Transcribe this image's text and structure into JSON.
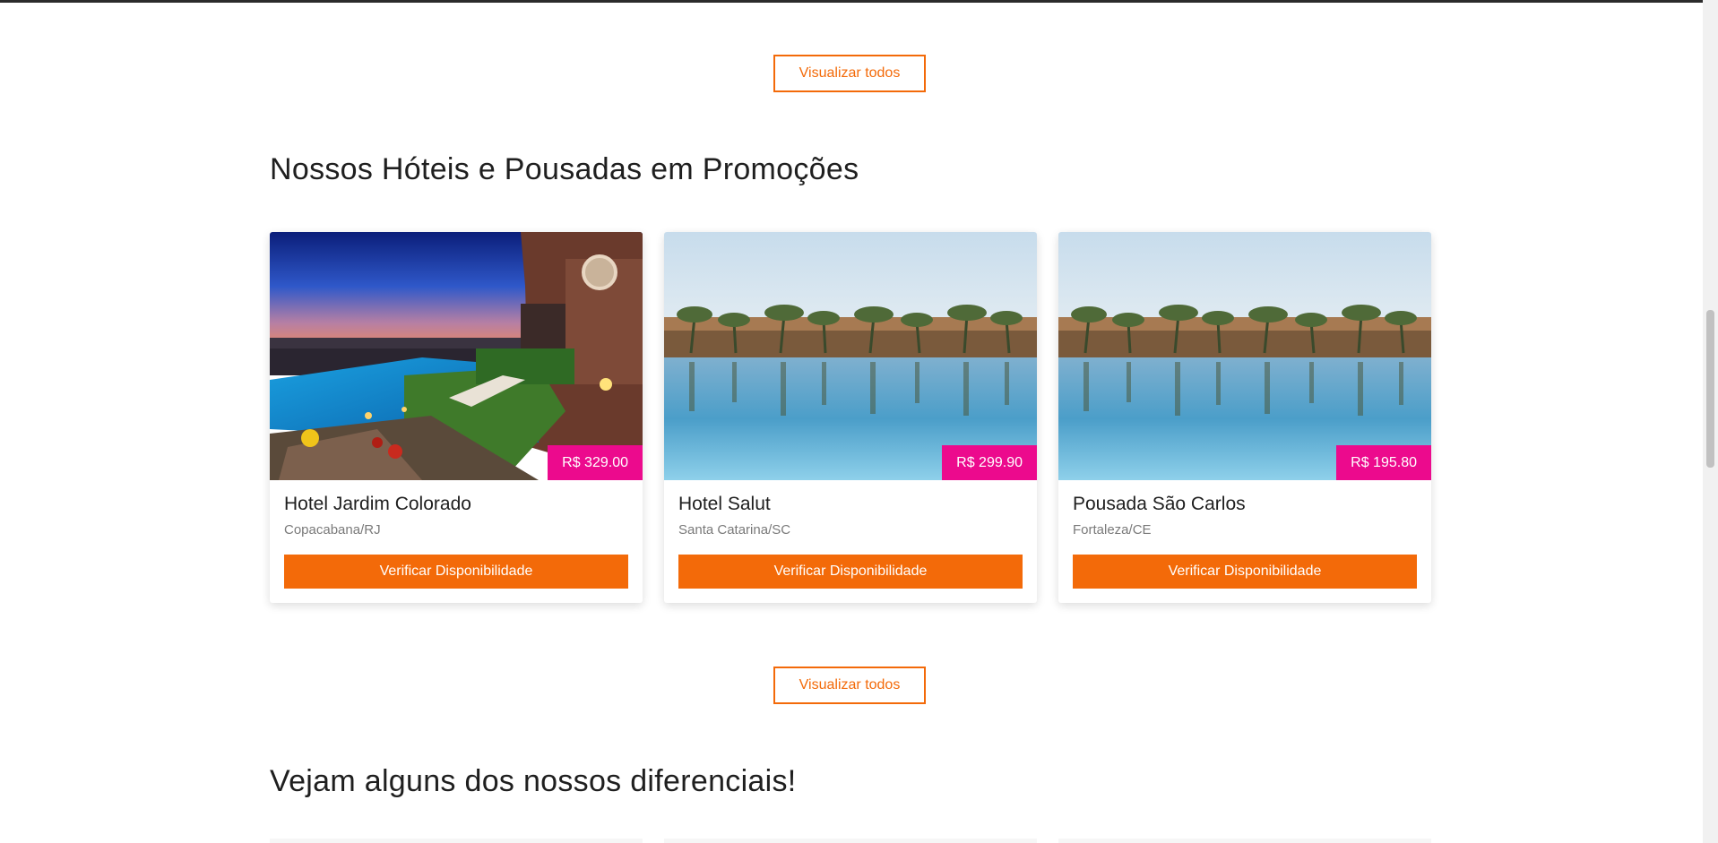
{
  "view_all_label": "Visualizar todos",
  "promotions": {
    "title": "Nossos Hóteis e Pousadas em Promoções",
    "cta_label": "Verificar Disponibilidade",
    "hotels": [
      {
        "name": "Hotel Jardim Colorado",
        "location": "Copacabana/RJ",
        "price": "R$ 329.00",
        "image": "sunset-villa-pool-photo"
      },
      {
        "name": "Hotel Salut",
        "location": "Santa Catarina/SC",
        "price": "R$ 299.90",
        "image": "palm-resort-pool-photo"
      },
      {
        "name": "Pousada São Carlos",
        "location": "Fortaleza/CE",
        "price": "R$ 195.80",
        "image": "palm-resort-pool-photo"
      }
    ]
  },
  "features": {
    "title": "Vejam alguns dos nossos diferenciais!"
  },
  "colors": {
    "accent": "#f36a09",
    "price_badge": "#ec0a8d",
    "text": "#1f1f1f",
    "muted": "#7a7a7a"
  }
}
